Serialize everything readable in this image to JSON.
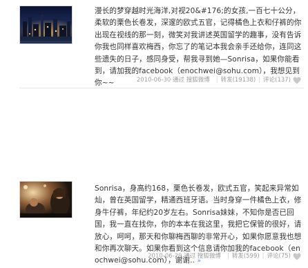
{
  "posts": [
    {
      "text": "漫长的梦穿越时光海洋,对视20&#176;的女孩,一百七十公分，柔软的栗色长卷发，深邃的欧式五官，记得橘色上衣和仔裤的你出现在视线的那一刻，微笑对我讲述英国留学的趣事，没有告诉你我也同样喜欢梅西，你忘了的笔记本我会亲手还给你，连同这些遗失的日子，感同身受，帮我寻到她—Sonrisa，如果你能看到，请加我的facebook（enochwei@sohu.com），我想见到你~~",
      "time": "2010-06-30 ",
      "time_tail": "通过 搜狐微博",
      "repost_label": "转发(19138)",
      "comment_label": "评论(137)",
      "image_alt": "night-city-photo"
    },
    {
      "text": "Sonrisa，身高约168，栗色长卷发，欧式五官，笑起来异常如灿，曾在英国留学，精通西班牙语。当时身穿一件橘色上衣，修身牛仔裤，年纪约20岁左右。Sonrisa妹妹，不知你是否已回国，我一直在找你，你的本本在我这里，我把它保管的很好，请放心，呵呵，那天和你聊梅西聊的非常开心，如果你愿意我也想和你再次聊天。如果你看到这个信息请你加我的facebook（enochwei@sohu.com），谢谢..",
      "more_label": "»",
      "time": "2010-06-29 ",
      "time_tail": "通过 搜狐微博",
      "repost_label": "转发(599)",
      "comment_label": "评论(75)",
      "image_alt": "concert-photo"
    }
  ],
  "colors": {
    "text": "#333333",
    "meta": "#a0a0a0",
    "heart": "#c8c8c8",
    "more": "#5b8fd0"
  }
}
